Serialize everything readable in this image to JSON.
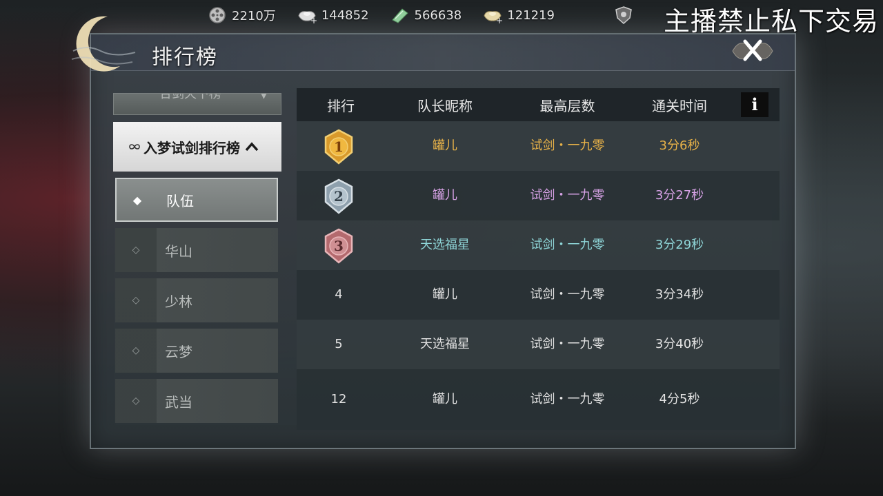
{
  "currencies": [
    {
      "icon": "film-reel-icon",
      "value": "2210万"
    },
    {
      "icon": "silver-ingot-plus-icon",
      "value": "144852"
    },
    {
      "icon": "jade-ticket-icon",
      "value": "566638"
    },
    {
      "icon": "gold-ingot-plus-icon",
      "value": "121219"
    }
  ],
  "stream_notice": "主播禁止私下交易",
  "panel": {
    "title": "排行榜"
  },
  "sidebar": {
    "category_previous": "合剑天下榜",
    "category_current": "入梦试剑排行榜",
    "items": [
      {
        "label": "队伍",
        "active": true
      },
      {
        "label": "华山",
        "active": false
      },
      {
        "label": "少林",
        "active": false
      },
      {
        "label": "云梦",
        "active": false
      },
      {
        "label": "武当",
        "active": false
      }
    ]
  },
  "table": {
    "headers": [
      "排行",
      "队长昵称",
      "最高层数",
      "通关时间"
    ],
    "info_label": "i",
    "rows": [
      {
        "rank": "1",
        "name": "罐儿",
        "floor": "试剑・一九零",
        "time": "3分6秒",
        "color": "#e8b248",
        "medal": "gold"
      },
      {
        "rank": "2",
        "name": "罐儿",
        "floor": "试剑・一九零",
        "time": "3分27秒",
        "color": "#d7a2e6",
        "medal": "silver"
      },
      {
        "rank": "3",
        "name": "天选福星",
        "floor": "试剑・一九零",
        "time": "3分29秒",
        "color": "#8fd6d8",
        "medal": "bronze"
      },
      {
        "rank": "4",
        "name": "罐儿",
        "floor": "试剑・一九零",
        "time": "3分34秒",
        "color": "#e2e2e2",
        "medal": ""
      },
      {
        "rank": "5",
        "name": "天选福星",
        "floor": "试剑・一九零",
        "time": "3分40秒",
        "color": "#e2e2e2",
        "medal": ""
      },
      {
        "rank": "12",
        "name": "罐儿",
        "floor": "试剑・一九零",
        "time": "4分5秒",
        "color": "#e2e2e2",
        "medal": ""
      }
    ]
  }
}
